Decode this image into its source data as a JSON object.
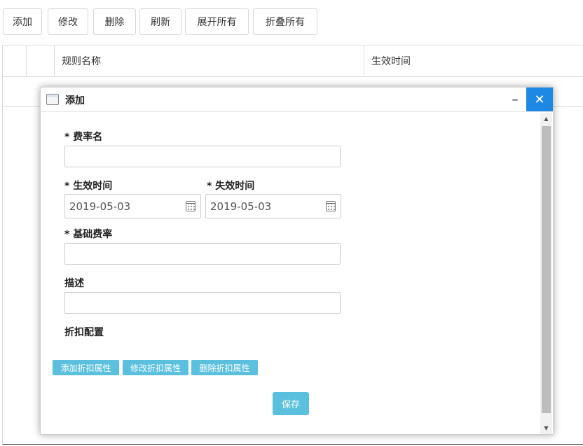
{
  "toolbar": {
    "add": "添加",
    "edit": "修改",
    "delete": "删除",
    "refresh": "刷新",
    "expand_all": "展开所有",
    "collapse_all": "折叠所有"
  },
  "grid": {
    "columns": [
      "规则名称",
      "生效时间"
    ]
  },
  "modal": {
    "title": "添加",
    "minimize": "–",
    "close": "✕",
    "fields": {
      "rate_name": {
        "label": "* 费率名",
        "value": ""
      },
      "effective_time": {
        "label": "* 生效时间",
        "value": "2019-05-03"
      },
      "expiry_time": {
        "label": "* 失效时间",
        "value": "2019-05-03"
      },
      "base_rate": {
        "label": "* 基础费率",
        "value": ""
      },
      "description": {
        "label": "描述",
        "value": ""
      }
    },
    "discount_section_label": "折扣配置",
    "discount_buttons": {
      "add": "添加折扣属性",
      "edit": "修改折扣属性",
      "delete": "删除折扣属性"
    },
    "save": "保存"
  },
  "icons": {
    "window": "window-icon",
    "calendar": "calendar-icon",
    "scroll_up": "▲",
    "scroll_down": "▼"
  },
  "colors": {
    "close_button": "#1e88e5",
    "info_button": "#5bc0de"
  }
}
